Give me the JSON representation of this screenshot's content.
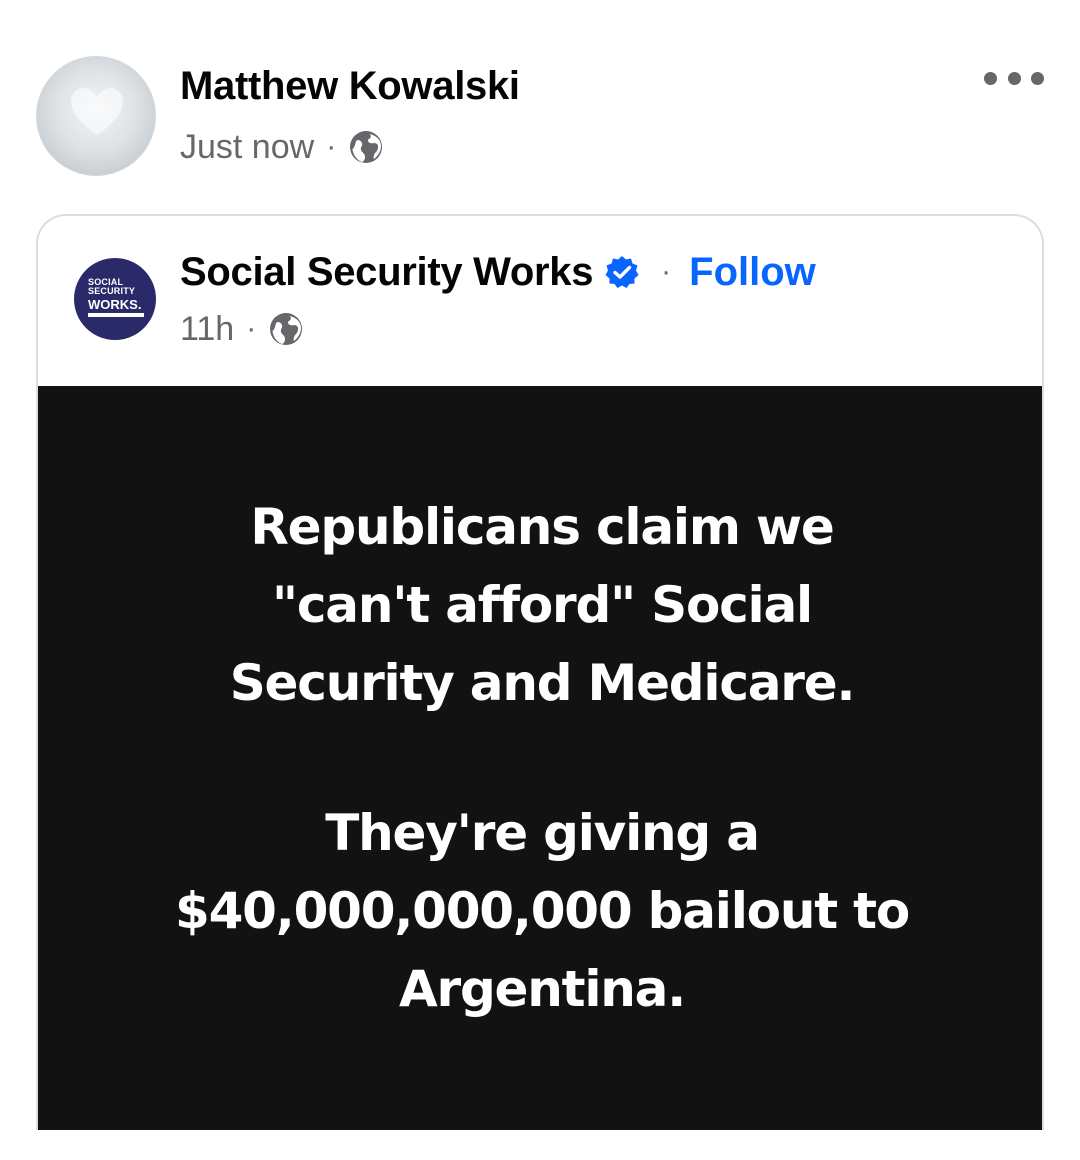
{
  "post": {
    "author": {
      "name": "Matthew Kowalski",
      "timestamp": "Just now",
      "separator": "·",
      "privacy_icon": "globe-icon"
    },
    "more_icon": "more-options-icon"
  },
  "shared_post": {
    "page": {
      "name": "Social Security Works",
      "verified_icon": "verified-badge-icon",
      "separator": "·",
      "follow_label": "Follow",
      "timestamp": "11h",
      "meta_separator": "·",
      "privacy_icon": "globe-icon",
      "logo": {
        "line1": "SOCIAL",
        "line2": "SECURITY",
        "line3": "WORKS."
      }
    },
    "image_text": {
      "block1": [
        "Republicans claim we",
        "\"can't afford\" Social",
        "Security and Medicare."
      ],
      "block2": [
        "They're giving a",
        "$40,000,000,000 bailout to",
        "Argentina."
      ]
    }
  },
  "colors": {
    "follow": "#0866ff",
    "verified": "#0866ff",
    "meta_text": "#65676b",
    "image_background": "#121212"
  }
}
